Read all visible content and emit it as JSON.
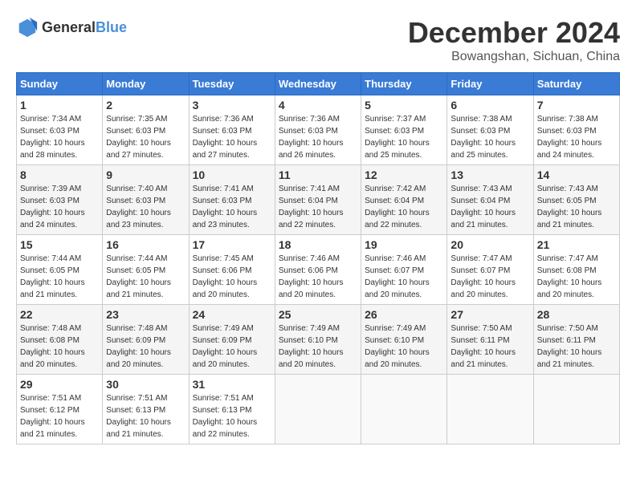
{
  "logo": {
    "general": "General",
    "blue": "Blue"
  },
  "title": "December 2024",
  "location": "Bowangshan, Sichuan, China",
  "days_of_week": [
    "Sunday",
    "Monday",
    "Tuesday",
    "Wednesday",
    "Thursday",
    "Friday",
    "Saturday"
  ],
  "weeks": [
    [
      {
        "day": "1",
        "rise": "7:34 AM",
        "set": "6:03 PM",
        "daylight": "10 hours and 28 minutes."
      },
      {
        "day": "2",
        "rise": "7:35 AM",
        "set": "6:03 PM",
        "daylight": "10 hours and 27 minutes."
      },
      {
        "day": "3",
        "rise": "7:36 AM",
        "set": "6:03 PM",
        "daylight": "10 hours and 27 minutes."
      },
      {
        "day": "4",
        "rise": "7:36 AM",
        "set": "6:03 PM",
        "daylight": "10 hours and 26 minutes."
      },
      {
        "day": "5",
        "rise": "7:37 AM",
        "set": "6:03 PM",
        "daylight": "10 hours and 25 minutes."
      },
      {
        "day": "6",
        "rise": "7:38 AM",
        "set": "6:03 PM",
        "daylight": "10 hours and 25 minutes."
      },
      {
        "day": "7",
        "rise": "7:38 AM",
        "set": "6:03 PM",
        "daylight": "10 hours and 24 minutes."
      }
    ],
    [
      {
        "day": "8",
        "rise": "7:39 AM",
        "set": "6:03 PM",
        "daylight": "10 hours and 24 minutes."
      },
      {
        "day": "9",
        "rise": "7:40 AM",
        "set": "6:03 PM",
        "daylight": "10 hours and 23 minutes."
      },
      {
        "day": "10",
        "rise": "7:41 AM",
        "set": "6:03 PM",
        "daylight": "10 hours and 23 minutes."
      },
      {
        "day": "11",
        "rise": "7:41 AM",
        "set": "6:04 PM",
        "daylight": "10 hours and 22 minutes."
      },
      {
        "day": "12",
        "rise": "7:42 AM",
        "set": "6:04 PM",
        "daylight": "10 hours and 22 minutes."
      },
      {
        "day": "13",
        "rise": "7:43 AM",
        "set": "6:04 PM",
        "daylight": "10 hours and 21 minutes."
      },
      {
        "day": "14",
        "rise": "7:43 AM",
        "set": "6:05 PM",
        "daylight": "10 hours and 21 minutes."
      }
    ],
    [
      {
        "day": "15",
        "rise": "7:44 AM",
        "set": "6:05 PM",
        "daylight": "10 hours and 21 minutes."
      },
      {
        "day": "16",
        "rise": "7:44 AM",
        "set": "6:05 PM",
        "daylight": "10 hours and 21 minutes."
      },
      {
        "day": "17",
        "rise": "7:45 AM",
        "set": "6:06 PM",
        "daylight": "10 hours and 20 minutes."
      },
      {
        "day": "18",
        "rise": "7:46 AM",
        "set": "6:06 PM",
        "daylight": "10 hours and 20 minutes."
      },
      {
        "day": "19",
        "rise": "7:46 AM",
        "set": "6:07 PM",
        "daylight": "10 hours and 20 minutes."
      },
      {
        "day": "20",
        "rise": "7:47 AM",
        "set": "6:07 PM",
        "daylight": "10 hours and 20 minutes."
      },
      {
        "day": "21",
        "rise": "7:47 AM",
        "set": "6:08 PM",
        "daylight": "10 hours and 20 minutes."
      }
    ],
    [
      {
        "day": "22",
        "rise": "7:48 AM",
        "set": "6:08 PM",
        "daylight": "10 hours and 20 minutes."
      },
      {
        "day": "23",
        "rise": "7:48 AM",
        "set": "6:09 PM",
        "daylight": "10 hours and 20 minutes."
      },
      {
        "day": "24",
        "rise": "7:49 AM",
        "set": "6:09 PM",
        "daylight": "10 hours and 20 minutes."
      },
      {
        "day": "25",
        "rise": "7:49 AM",
        "set": "6:10 PM",
        "daylight": "10 hours and 20 minutes."
      },
      {
        "day": "26",
        "rise": "7:49 AM",
        "set": "6:10 PM",
        "daylight": "10 hours and 20 minutes."
      },
      {
        "day": "27",
        "rise": "7:50 AM",
        "set": "6:11 PM",
        "daylight": "10 hours and 21 minutes."
      },
      {
        "day": "28",
        "rise": "7:50 AM",
        "set": "6:11 PM",
        "daylight": "10 hours and 21 minutes."
      }
    ],
    [
      {
        "day": "29",
        "rise": "7:51 AM",
        "set": "6:12 PM",
        "daylight": "10 hours and 21 minutes."
      },
      {
        "day": "30",
        "rise": "7:51 AM",
        "set": "6:13 PM",
        "daylight": "10 hours and 21 minutes."
      },
      {
        "day": "31",
        "rise": "7:51 AM",
        "set": "6:13 PM",
        "daylight": "10 hours and 22 minutes."
      },
      null,
      null,
      null,
      null
    ]
  ],
  "labels": {
    "sunrise": "Sunrise:",
    "sunset": "Sunset:",
    "daylight": "Daylight:"
  }
}
